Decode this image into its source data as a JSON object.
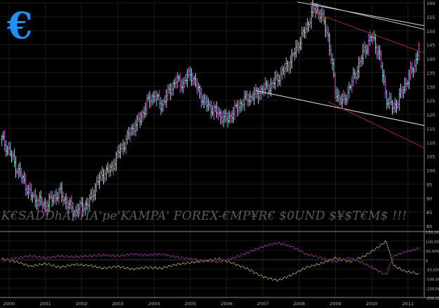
{
  "branding": {
    "logo_glyph": "€",
    "logo_color": "#1e90ff"
  },
  "watermark": "K€SADDhAPHA'pe'KAMPA' FOREX-€MP¥R€ $0UND $¥$T€M$ !!!",
  "chart_data": [
    {
      "type": "ohlc",
      "ylim": [
        78,
        160
      ],
      "yticks": [
        80,
        85,
        90,
        95,
        100,
        105,
        110,
        115,
        120,
        125,
        130,
        135,
        140,
        145,
        150,
        155,
        160
      ],
      "x_ticks": [
        "2000",
        "2001",
        "2002",
        "2003",
        "2004",
        "2005",
        "2006",
        "2007",
        "2008",
        "2009",
        "2010",
        "2011"
      ],
      "x_tick_pos": [
        2000,
        2001,
        2002,
        2003,
        2004,
        2005,
        2006,
        2007,
        2008,
        2009,
        2010,
        2011
      ],
      "xlim": [
        1999.75,
        2011.45
      ],
      "grid": true,
      "series": [
        {
          "x": [
            1999.8,
            2000.0,
            2000.2,
            2000.4,
            2000.6,
            2000.8,
            2001.0,
            2001.2,
            2001.4,
            2001.6,
            2001.8,
            2002.0,
            2002.2,
            2002.4,
            2002.6,
            2002.8,
            2003.0,
            2003.2,
            2003.4,
            2003.6,
            2003.8,
            2004.0,
            2004.2,
            2004.4,
            2004.6,
            2004.8,
            2005.0,
            2005.2,
            2005.4,
            2005.6,
            2005.8,
            2006.0,
            2006.2,
            2006.4,
            2006.6,
            2006.8,
            2007.0,
            2007.2,
            2007.4,
            2007.6,
            2007.8,
            2008.0,
            2008.2,
            2008.4,
            2008.6,
            2008.8,
            2009.0,
            2009.2,
            2009.4,
            2009.6,
            2009.8,
            2010.0,
            2010.2,
            2010.4,
            2010.6,
            2010.8,
            2011.0,
            2011.2,
            2011.3
          ],
          "close": [
            111,
            107,
            101,
            96,
            91,
            89,
            87,
            90,
            92,
            88,
            85,
            87,
            88,
            95,
            99,
            100,
            106,
            110,
            115,
            118,
            124,
            127,
            123,
            128,
            132,
            131,
            135,
            129,
            124,
            122,
            120,
            118,
            121,
            124,
            126,
            127,
            129,
            130,
            133,
            136,
            140,
            146,
            151,
            158,
            156,
            148,
            128,
            124,
            130,
            136,
            143,
            148,
            142,
            126,
            122,
            127,
            133,
            138,
            145
          ]
        }
      ],
      "trendlines": [
        {
          "color": "#d8d8d8",
          "points": [
            [
              2007.95,
              160.3
            ],
            [
              2011.45,
              151.8
            ]
          ]
        },
        {
          "color": "#c0c0c0",
          "points": [
            [
              2008.3,
              160
            ],
            [
              2011.45,
              150.5
            ]
          ]
        },
        {
          "color": "#e8e8e8",
          "points": [
            [
              2006.8,
              128.5
            ],
            [
              2011.45,
              116
            ]
          ]
        },
        {
          "color": "#a0282a",
          "points": [
            [
              2008.4,
              156.5
            ],
            [
              2011.45,
              142
            ]
          ]
        },
        {
          "color": "#a0282a",
          "points": [
            [
              2008.8,
              124.5
            ],
            [
              2011.45,
              108
            ]
          ]
        }
      ]
    },
    {
      "type": "line",
      "ylim": [
        -200000,
        150000
      ],
      "yticks": [
        -200000,
        -150000,
        -100000,
        -50000,
        0,
        50000,
        100000,
        150000
      ],
      "ytick_labels": [
        "-200,000",
        "-150,000",
        "-100,000",
        "-50,000",
        "0",
        "50,000",
        "100,000",
        "150,000"
      ],
      "xlim": [
        1999.75,
        2011.45
      ],
      "grid": true,
      "series": [
        {
          "color": "#d0d070",
          "x": [
            1999.8,
            2000.2,
            2000.6,
            2001.0,
            2001.4,
            2001.8,
            2002.2,
            2002.6,
            2003.0,
            2003.4,
            2003.8,
            2004.2,
            2004.6,
            2005.0,
            2005.4,
            2005.8,
            2006.2,
            2006.6,
            2007.0,
            2007.4,
            2007.8,
            2008.2,
            2008.6,
            2009.0,
            2009.4,
            2009.8,
            2010.2,
            2010.4,
            2010.6,
            2010.9,
            2011.2,
            2011.3
          ],
          "y": [
            5000,
            -10000,
            -35000,
            -20000,
            -40000,
            -25000,
            -30000,
            -45000,
            -35000,
            -50000,
            -40000,
            -45000,
            -25000,
            -15000,
            -5000,
            5000,
            -20000,
            -50000,
            -90000,
            -110000,
            -80000,
            -40000,
            -20000,
            10000,
            -10000,
            20000,
            70000,
            100000,
            -30000,
            -60000,
            -70000,
            -80000
          ]
        },
        {
          "color": "#c040c0",
          "x": [
            1999.8,
            2000.2,
            2000.6,
            2001.0,
            2001.4,
            2001.8,
            2002.2,
            2002.6,
            2003.0,
            2003.4,
            2003.8,
            2004.2,
            2004.6,
            2005.0,
            2005.4,
            2005.8,
            2006.2,
            2006.6,
            2007.0,
            2007.4,
            2007.8,
            2008.2,
            2008.6,
            2009.0,
            2009.4,
            2009.8,
            2010.2,
            2010.4,
            2010.6,
            2010.9,
            2011.2,
            2011.3
          ],
          "y": [
            -5000,
            10000,
            20000,
            10000,
            20000,
            15000,
            20000,
            25000,
            20000,
            30000,
            25000,
            30000,
            15000,
            5000,
            -5000,
            -10000,
            10000,
            40000,
            70000,
            90000,
            70000,
            30000,
            10000,
            -10000,
            10000,
            -20000,
            -60000,
            -80000,
            20000,
            40000,
            55000,
            60000
          ]
        }
      ]
    }
  ]
}
